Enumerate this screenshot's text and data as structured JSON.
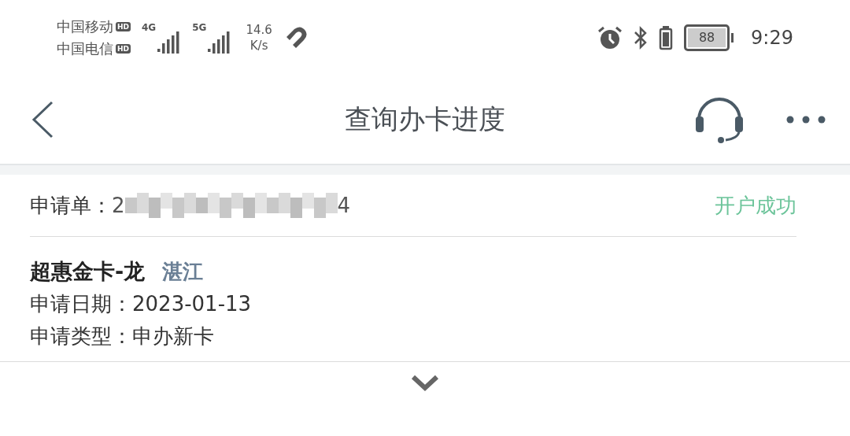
{
  "status_bar": {
    "carriers": [
      {
        "name": "中国移动",
        "badge": "HD"
      },
      {
        "name": "中国电信",
        "badge": "HD"
      }
    ],
    "networks": [
      {
        "type": "4G"
      },
      {
        "type": "5G"
      }
    ],
    "speed": {
      "value": "14.6",
      "unit": "K/s"
    },
    "battery": "88",
    "time": "9:29"
  },
  "header": {
    "title": "查询办卡进度"
  },
  "application": {
    "label": "申请单：",
    "number_start": "2",
    "number_end": "4",
    "status": "开户成功"
  },
  "card": {
    "name": "超惠金卡-龙",
    "city": "湛江",
    "fields": [
      {
        "label": "申请日期：",
        "value": "2023-01-13"
      },
      {
        "label": "申请类型：",
        "value": "申办新卡"
      }
    ]
  }
}
